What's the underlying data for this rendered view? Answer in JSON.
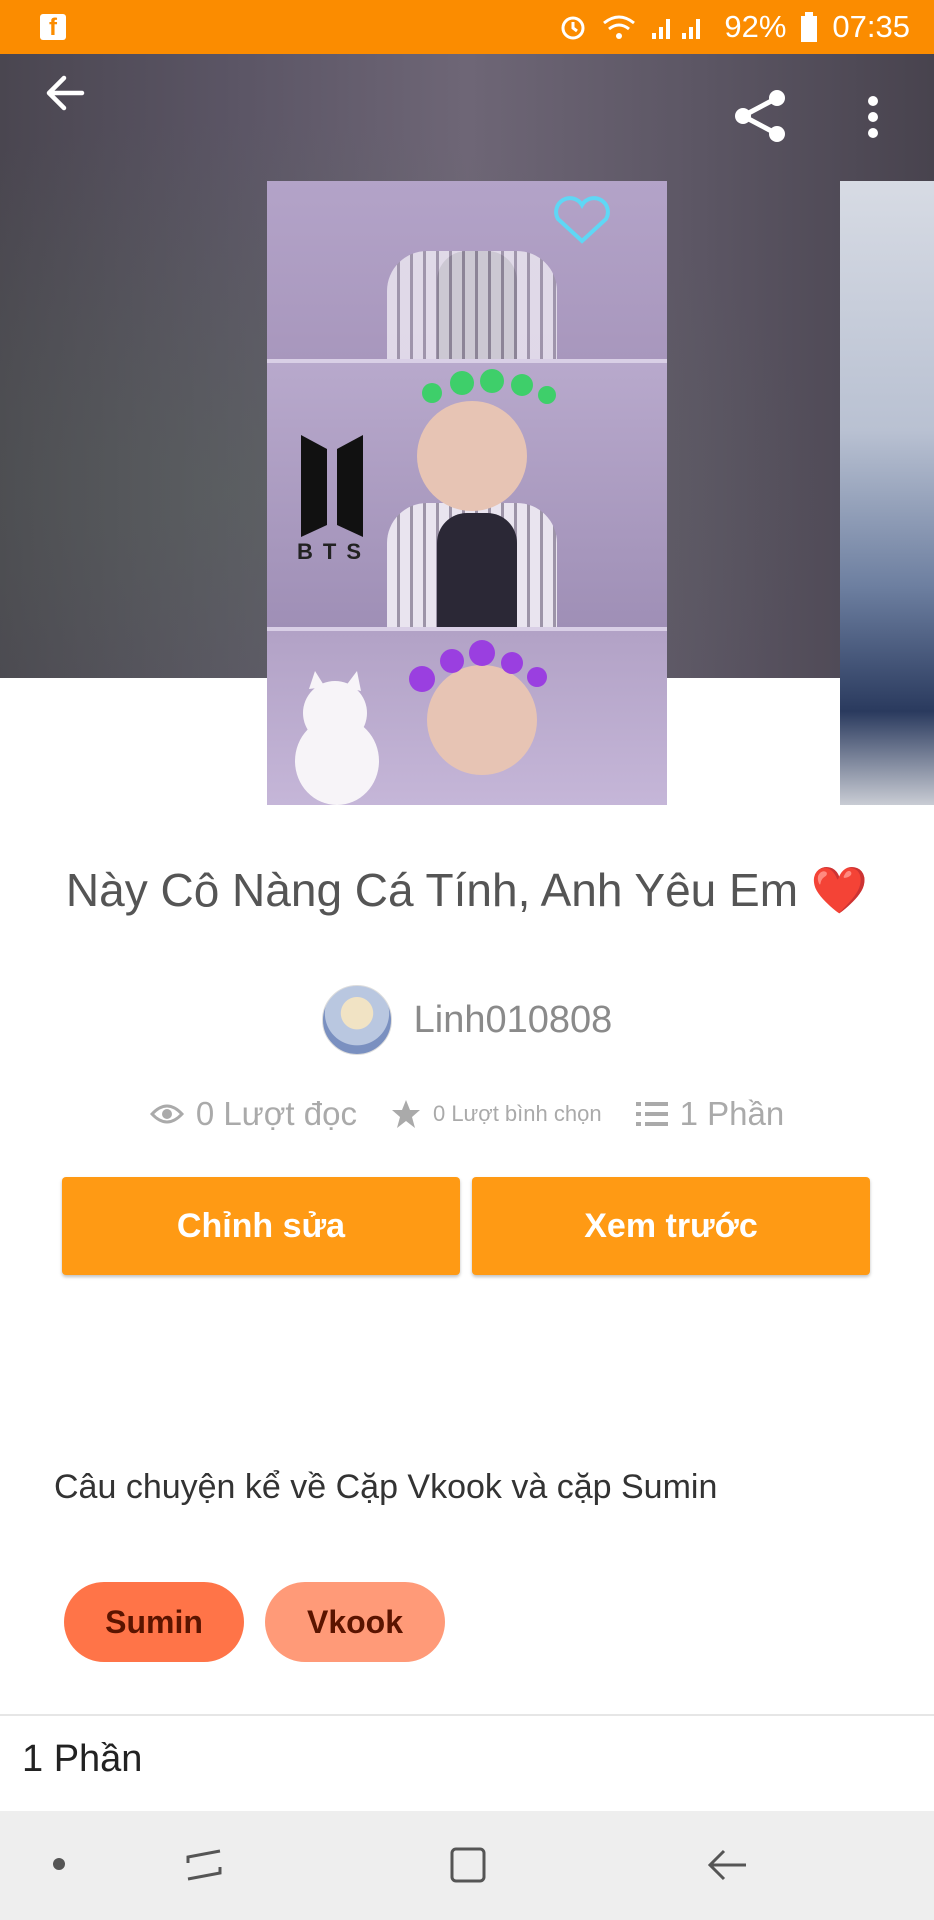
{
  "status_bar": {
    "battery": "92%",
    "time": "07:35",
    "icons": [
      "facebook-icon",
      "alarm-icon",
      "wifi-icon",
      "signal-icon",
      "battery-icon"
    ]
  },
  "top_bar": {
    "back_icon": "arrow-left-icon",
    "share_icon": "share-icon",
    "more_icon": "more-vertical-icon"
  },
  "story": {
    "title": "Này Cô Nàng Cá Tính, Anh Yêu Em ❤️",
    "cover_text": "BTS",
    "author": "Linh010808",
    "stats": {
      "reads": "0 Lượt đọc",
      "votes": "0 Lượt bình chọn",
      "parts": "1 Phần"
    },
    "description": "Câu chuyện kể về Cặp Vkook và cặp Sumin",
    "tags": [
      "Sumin",
      "Vkook"
    ],
    "parts_header": "1 Phần"
  },
  "actions": {
    "edit_label": "Chỉnh sửa",
    "preview_label": "Xem trước"
  },
  "colors": {
    "accent": "#ff9a14",
    "status_bar": "#fb8c00",
    "tag1": "#ff7448",
    "tag2": "#ff9a78"
  }
}
